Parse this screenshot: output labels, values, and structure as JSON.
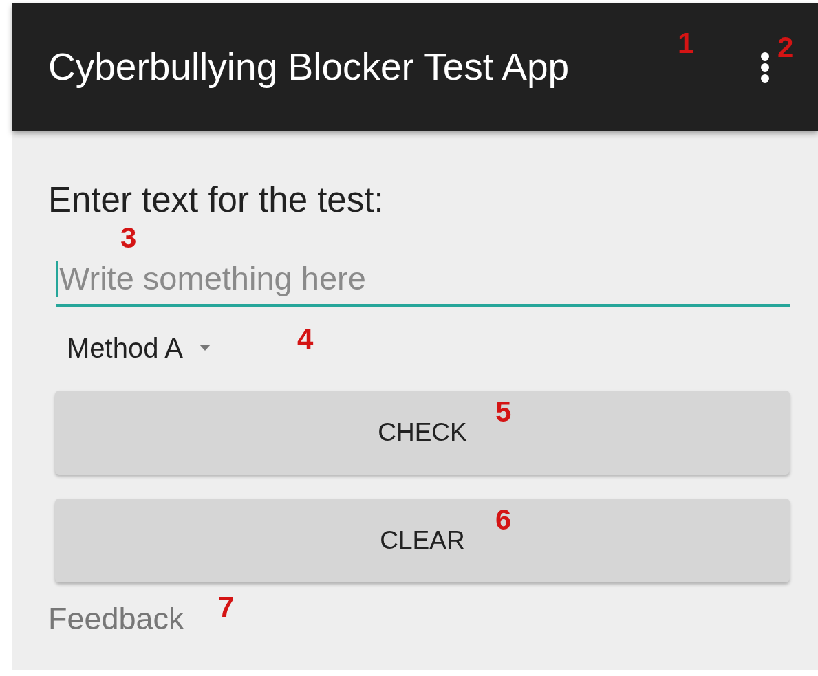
{
  "app_bar": {
    "title": "Cyberbullying Blocker Test App"
  },
  "prompt": "Enter text for the test:",
  "text_field": {
    "placeholder": "Write something here",
    "focused": true
  },
  "spinner": {
    "value": "Method A"
  },
  "buttons": [
    "CHECK",
    "CLEAR"
  ],
  "feedback": "Feedback",
  "markers": [
    "1",
    "2",
    "3",
    "4",
    "5",
    "6",
    "7"
  ]
}
